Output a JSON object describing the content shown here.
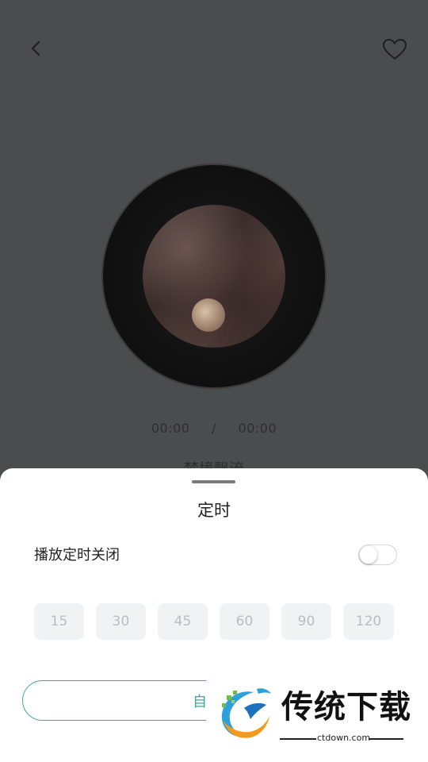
{
  "player": {
    "current_time": "00:00",
    "separator": "/",
    "total_time": "00:00",
    "track_title": "梦境飘流"
  },
  "icons": {
    "back": "chevron-left-icon",
    "favorite": "heart-outline-icon"
  },
  "timer_sheet": {
    "title": "定时",
    "toggle_label": "播放定时关闭",
    "toggle_on": false,
    "options": [
      "15",
      "30",
      "45",
      "60",
      "90",
      "120"
    ],
    "custom_label": "自定义"
  },
  "watermark": {
    "brand": "传统下载",
    "url": "ctdown.com"
  },
  "colors": {
    "accent": "#3aa79a",
    "overlay": "#4a4d4e",
    "option_bg": "#f1f2f4",
    "option_text": "#b9bcc1"
  }
}
